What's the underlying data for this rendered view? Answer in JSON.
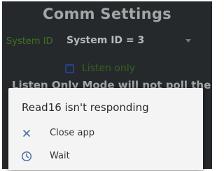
{
  "screen": {
    "title": "Comm Settings",
    "system_id": {
      "label": "System ID",
      "value": "System ID = 3",
      "arrow_icon": "dropdown-arrow-icon"
    },
    "listen_only": {
      "label": "Listen only",
      "checked": false
    },
    "info_text": "Listen Only Mode will not poll the"
  },
  "dialog": {
    "title": "Read16 isn't responding",
    "options": [
      {
        "icon": "close-icon",
        "label": "Close app"
      },
      {
        "icon": "clock-icon",
        "label": "Wait"
      }
    ]
  },
  "colors": {
    "background": "#2f3336",
    "title": "#c6cbcc",
    "green_label": "#4c8a2c",
    "checkbox_border": "#2d4fb0",
    "dialog_bg": "#f4f4f4",
    "icon": "#4a6fa5"
  }
}
